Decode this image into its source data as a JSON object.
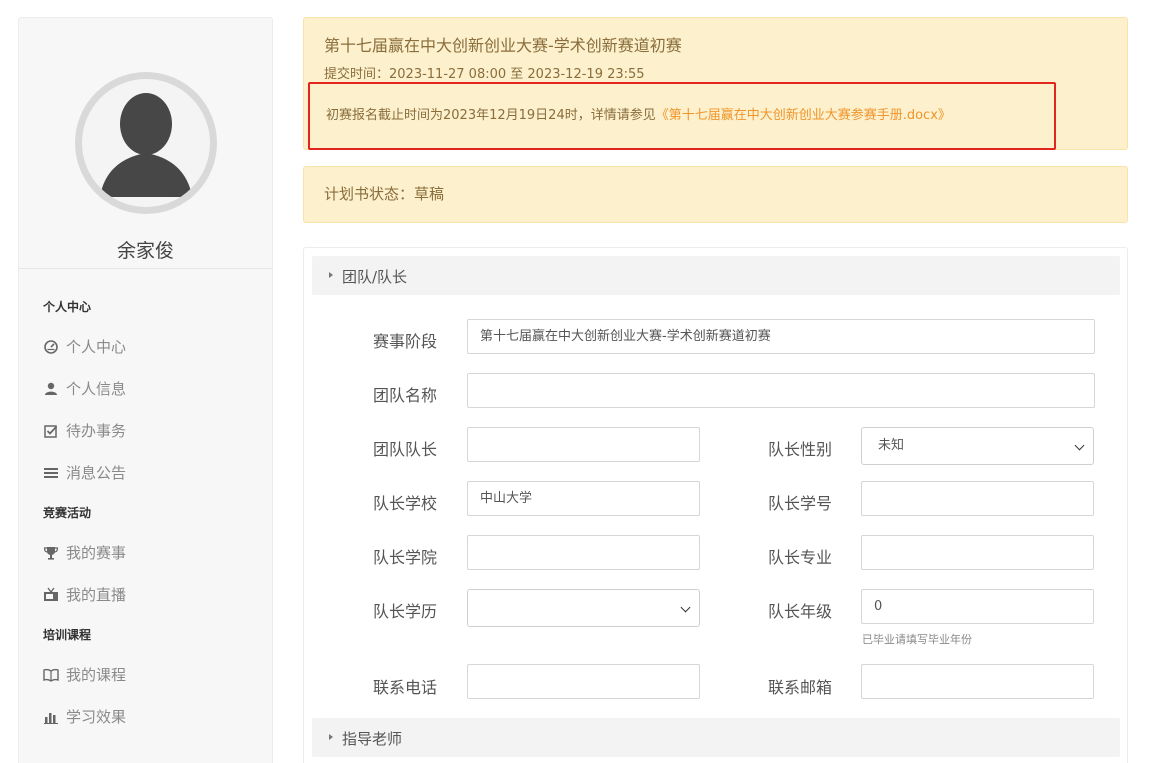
{
  "sidebar": {
    "username": "余家俊",
    "sections": [
      {
        "title": "个人中心",
        "items": [
          {
            "label": "个人中心",
            "icon": "dashboard-icon"
          },
          {
            "label": "个人信息",
            "icon": "user-icon"
          },
          {
            "label": "待办事务",
            "icon": "checkbox-icon"
          },
          {
            "label": "消息公告",
            "icon": "menu-lines-icon"
          }
        ]
      },
      {
        "title": "竞赛活动",
        "items": [
          {
            "label": "我的赛事",
            "icon": "trophy-icon"
          },
          {
            "label": "我的直播",
            "icon": "tv-icon"
          }
        ]
      },
      {
        "title": "培训课程",
        "items": [
          {
            "label": "我的课程",
            "icon": "book-icon"
          },
          {
            "label": "学习效果",
            "icon": "bar-chart-icon"
          }
        ]
      }
    ]
  },
  "notice": {
    "title": "第十七届赢在中大创新创业大赛-学术创新赛道初赛",
    "time": "提交时间：2023-11-27 08:00 至 2023-12-19 23:55",
    "deadline_text": "初赛报名截止时间为2023年12月19日24时，详情请参见",
    "link_text": "《第十七届赢在中大创新创业大赛参赛手册.docx》"
  },
  "status": {
    "text": "计划书状态：草稿"
  },
  "form": {
    "section_team": "团队/队长",
    "section_teacher": "指导老师",
    "fields": {
      "stage": {
        "label": "赛事阶段",
        "value": "第十七届赢在中大创新创业大赛-学术创新赛道初赛"
      },
      "team_name": {
        "label": "团队名称",
        "value": ""
      },
      "leader": {
        "label": "团队队长",
        "value": ""
      },
      "gender": {
        "label": "队长性别",
        "value": "未知"
      },
      "school": {
        "label": "队长学校",
        "value": "中山大学"
      },
      "student_id": {
        "label": "队长学号",
        "value": ""
      },
      "college": {
        "label": "队长学院",
        "value": ""
      },
      "major": {
        "label": "队长专业",
        "value": ""
      },
      "education": {
        "label": "队长学历",
        "value": ""
      },
      "grade": {
        "label": "队长年级",
        "value": "0",
        "hint": "已毕业请填写毕业年份"
      },
      "phone": {
        "label": "联系电话",
        "value": ""
      },
      "email": {
        "label": "联系邮箱",
        "value": ""
      }
    }
  },
  "colors": {
    "notice_bg": "#fcf0cd",
    "notice_text": "#8a6d3b",
    "link": "#f0952a",
    "highlight_border": "#e0261f"
  }
}
